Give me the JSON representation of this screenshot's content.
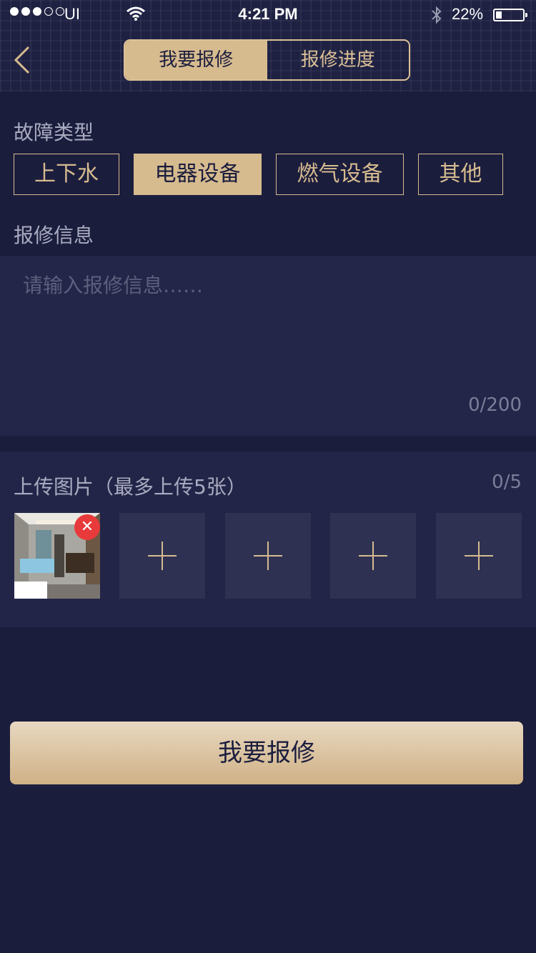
{
  "status_bar": {
    "carrier": "UI",
    "time": "4:21 PM",
    "battery": "22%",
    "battery_level": 0.22
  },
  "nav": {
    "tabs": [
      "我要报修",
      "报修进度"
    ],
    "active_tab": 0
  },
  "fault_type": {
    "label": "故障类型",
    "options": [
      "上下水",
      "电器设备",
      "燃气设备",
      "其他"
    ],
    "selected": "电器设备"
  },
  "repair_info": {
    "label": "报修信息",
    "placeholder": "请输入报修信息……",
    "value": "",
    "counter": "0/200"
  },
  "upload": {
    "title": "上传图片（最多上传5张）",
    "count": "0/5",
    "remove_symbol": "✕"
  },
  "submit": {
    "label": "我要报修"
  },
  "colors": {
    "background": "#1b1d3d",
    "accent": "#d6bb8f",
    "panel": "#232648",
    "remove": "#e83a3a"
  }
}
